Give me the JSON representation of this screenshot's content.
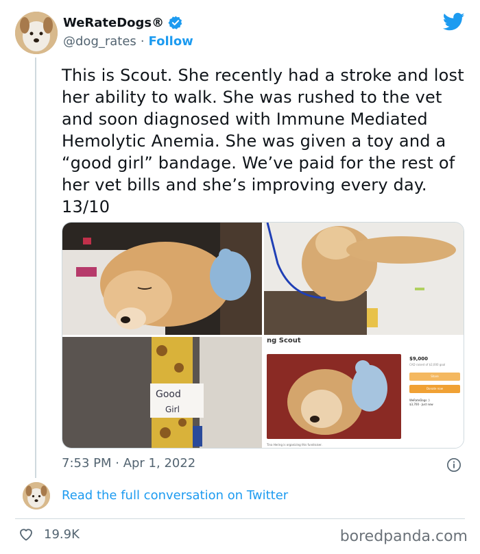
{
  "author": {
    "display_name": "WeRateDogs®",
    "handle": "@dog_rates",
    "separator": "·",
    "follow_label": "Follow"
  },
  "tweet": {
    "text": "This is Scout. She recently had a stroke and lost her ability to walk. She was rushed to the vet and soon diagnosed with Immune Mediated Hemolytic Anemia. She was given a toy and a “good girl” bandage. We’ve paid for the rest of her vet bills and she’s improving every day. 13/10",
    "timestamp": "7:53 PM · Apr 1, 2022"
  },
  "media": {
    "bandage_text_1": "Good",
    "bandage_text_2": "Girl",
    "fundraiser": {
      "title": "ng Scout",
      "amount": "$9,000",
      "amount_sub": "CAD raised of $2,000 goal",
      "donations": "96 donations",
      "share_label": "Share",
      "donate_label": "Donate now",
      "donor_name": "WeRateDogs :)",
      "donor_amount": "$3,700 · Just now",
      "footer": "Tina Hering is organizing this fundraiser."
    }
  },
  "conversation": {
    "read_label": "Read the full conversation on Twitter"
  },
  "engagement": {
    "likes": "19.9K"
  },
  "watermark": "boredpanda.com",
  "colors": {
    "accent": "#1d9bf0",
    "text_primary": "#0f1419",
    "text_secondary": "#536471",
    "border": "#cfd9de"
  },
  "icons": {
    "verified": "verified-badge-icon",
    "brand": "twitter-bird-icon",
    "info": "info-icon",
    "like": "heart-icon"
  }
}
